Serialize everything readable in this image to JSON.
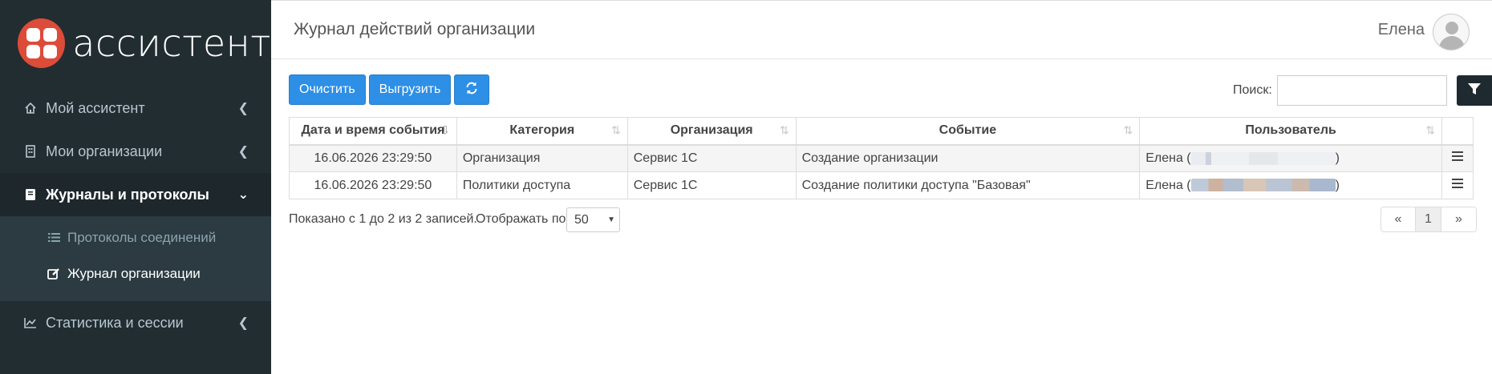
{
  "brand": {
    "name": "ассистент",
    "color": "#dd4b39"
  },
  "sidebar": {
    "items": [
      {
        "label": "Мой ассистент",
        "icon": "home-icon"
      },
      {
        "label": "Мои организации",
        "icon": "building-icon"
      },
      {
        "label": "Журналы и протоколы",
        "icon": "book-icon",
        "active": true
      },
      {
        "label": "Статистика и сессии",
        "icon": "line-chart-icon"
      }
    ],
    "subitems": [
      {
        "label": "Протоколы соединений",
        "icon": "list-icon"
      },
      {
        "label": "Журнал организации",
        "icon": "edit-icon",
        "active": true
      }
    ]
  },
  "header": {
    "title": "Журнал действий организации",
    "user": "Елена"
  },
  "toolbar": {
    "clear": "Очистить",
    "export": "Выгрузить",
    "refresh_icon": "refresh-icon"
  },
  "search": {
    "label": "Поиск:",
    "value": ""
  },
  "table": {
    "columns": [
      "Дата и время события",
      "Категория",
      "Организация",
      "Событие",
      "Пользователь"
    ],
    "rows": [
      {
        "datetime": "16.06.2026 23:29:50",
        "category": "Организация",
        "organization": "Сервис 1С",
        "event": "Создание организации",
        "user_prefix": "Елена (",
        "user_suffix": ")"
      },
      {
        "datetime": "16.06.2026 23:29:50",
        "category": "Политики доступа",
        "organization": "Сервис 1С",
        "event": "Создание политики доступа \"Базовая\"",
        "user_prefix": "Елена (",
        "user_suffix": ")"
      }
    ]
  },
  "footer": {
    "info": "Показано с 1 до 2 из 2 записей.",
    "length_label": "Отображать по",
    "length_value": "50",
    "pager": {
      "first": "«",
      "page": "1",
      "last": "»"
    }
  }
}
